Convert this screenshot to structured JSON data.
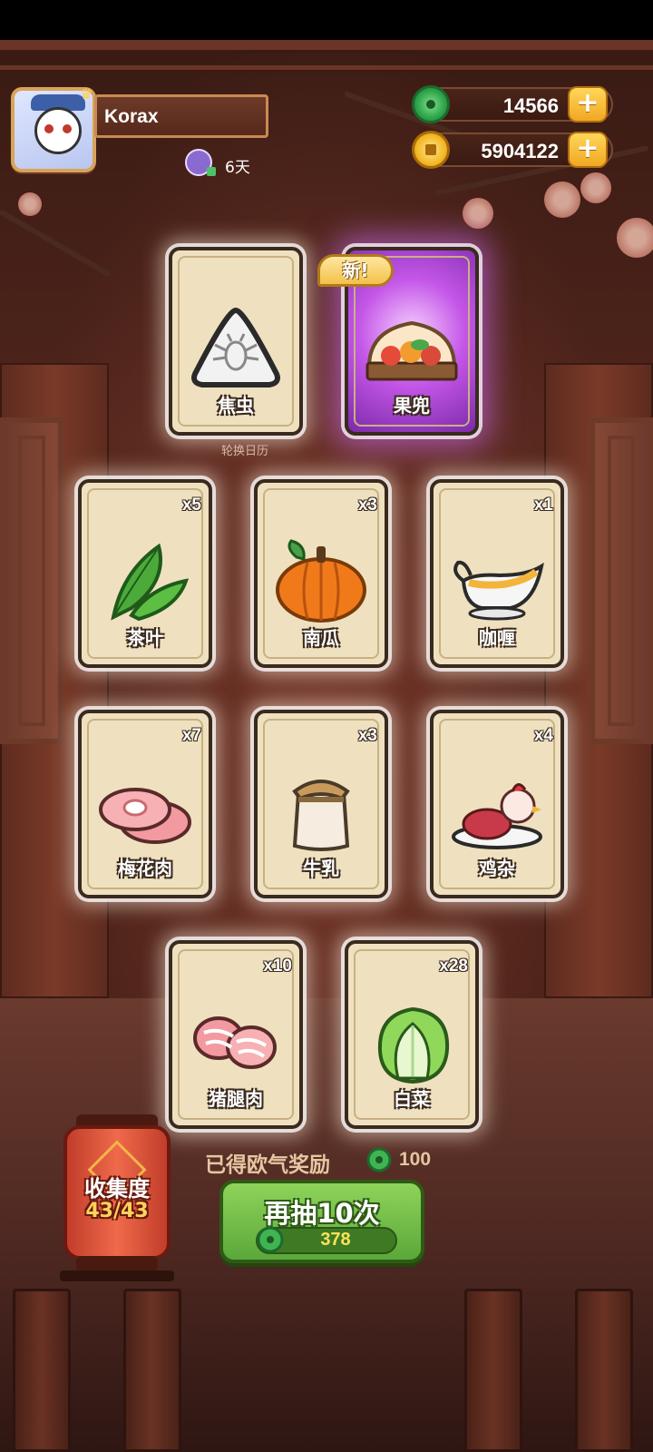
{
  "player": {
    "name": "Korax",
    "days": "6天"
  },
  "resources": {
    "jade": "14566",
    "coins": "5904122"
  },
  "badge": {
    "new": "新!"
  },
  "rotation_label": "轮换日历",
  "cards": [
    {
      "label": "焦虫",
      "count": "",
      "icon": "bug-silhouette-icon"
    },
    {
      "label": "果兜",
      "count": "",
      "icon": "fruit-basket-icon"
    },
    {
      "label": "茶叶",
      "count": "x5",
      "icon": "tea-leaves-icon"
    },
    {
      "label": "南瓜",
      "count": "x3",
      "icon": "pumpkin-icon"
    },
    {
      "label": "咖喱",
      "count": "x1",
      "icon": "curry-boat-icon"
    },
    {
      "label": "梅花肉",
      "count": "x7",
      "icon": "pork-shoulder-icon"
    },
    {
      "label": "牛乳",
      "count": "x3",
      "icon": "milk-jar-icon"
    },
    {
      "label": "鸡杂",
      "count": "x4",
      "icon": "chicken-giblets-icon"
    },
    {
      "label": "猪腿肉",
      "count": "x10",
      "icon": "pork-leg-icon"
    },
    {
      "label": "白菜",
      "count": "x28",
      "icon": "cabbage-icon"
    }
  ],
  "collection": {
    "title": "收集度",
    "value": "43/43"
  },
  "reward": {
    "label": "已得欧气奖励",
    "value": "100"
  },
  "draw_button": {
    "label": "再抽10次",
    "cost": "378"
  },
  "colors": {
    "jade": "#2ea44a",
    "coin": "#f2b521",
    "draw_button": "#6cbf44",
    "special_card_glow": "#c456e8"
  }
}
